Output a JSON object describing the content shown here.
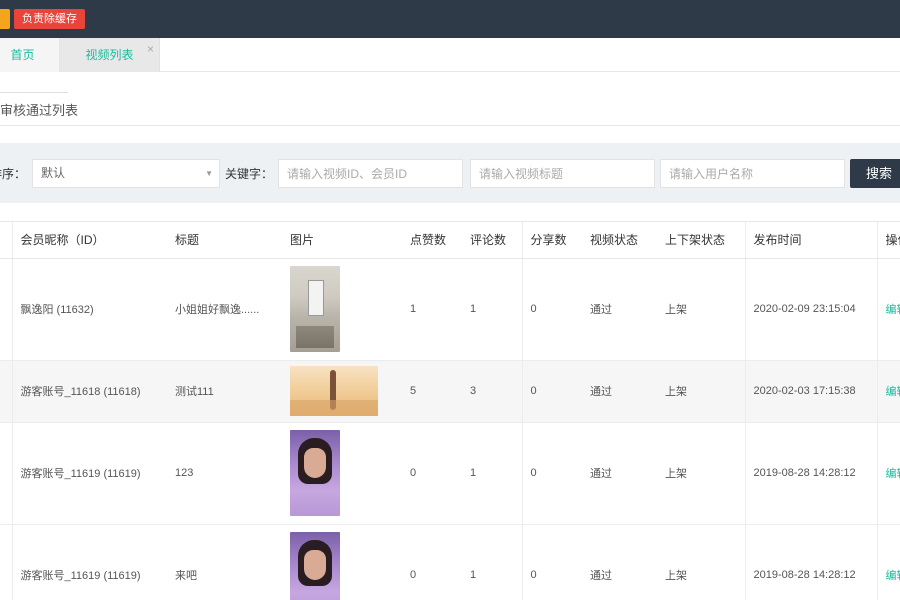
{
  "topbar": {
    "clear_cache_label": "负责除缓存"
  },
  "tabs": [
    {
      "label": "首页"
    },
    {
      "label": "视频列表",
      "close": "×"
    }
  ],
  "section": {
    "title": "审核通过列表"
  },
  "filter": {
    "sort_label": "排序：",
    "sort_value": "默认",
    "keyword_label": "关键字：",
    "placeholder_id": "请输入视频ID、会员ID",
    "placeholder_title": "请输入视频标题",
    "placeholder_user": "请输入用户名称",
    "search_label": "搜索"
  },
  "table": {
    "headers": [
      "",
      "会员昵称（ID）",
      "标题",
      "图片",
      "点赞数",
      "评论数",
      "分享数",
      "视频状态",
      "上下架状态",
      "发布时间",
      "操作"
    ],
    "rows": [
      {
        "id": "",
        "member": "飘逸阳 (11632)",
        "title": "小姐姐好飘逸......",
        "likes": "1",
        "comments": "1",
        "shares": "0",
        "status": "通过",
        "shelf": "上架",
        "time": "2020-02-09 23:15:04",
        "op": "编辑"
      },
      {
        "id": "",
        "member": "游客账号_11618 (11618)",
        "title": "测试111",
        "likes": "5",
        "comments": "3",
        "shares": "0",
        "status": "通过",
        "shelf": "上架",
        "time": "2020-02-03 17:15:38",
        "op": "编辑"
      },
      {
        "id": "",
        "member": "游客账号_11619 (11619)",
        "title": "123",
        "likes": "0",
        "comments": "1",
        "shares": "0",
        "status": "通过",
        "shelf": "上架",
        "time": "2019-08-28 14:28:12",
        "op": "编辑"
      },
      {
        "id": "",
        "member": "游客账号_11619 (11619)",
        "title": "来吧",
        "likes": "0",
        "comments": "1",
        "shares": "0",
        "status": "通过",
        "shelf": "上架",
        "time": "2019-08-28 14:28:12",
        "op": "编辑"
      }
    ]
  },
  "colors": {
    "topbar": "#2f3a48",
    "clear_button": "#e8443a",
    "accent": "#1abc9c",
    "filter_bg": "#eef1f4"
  }
}
